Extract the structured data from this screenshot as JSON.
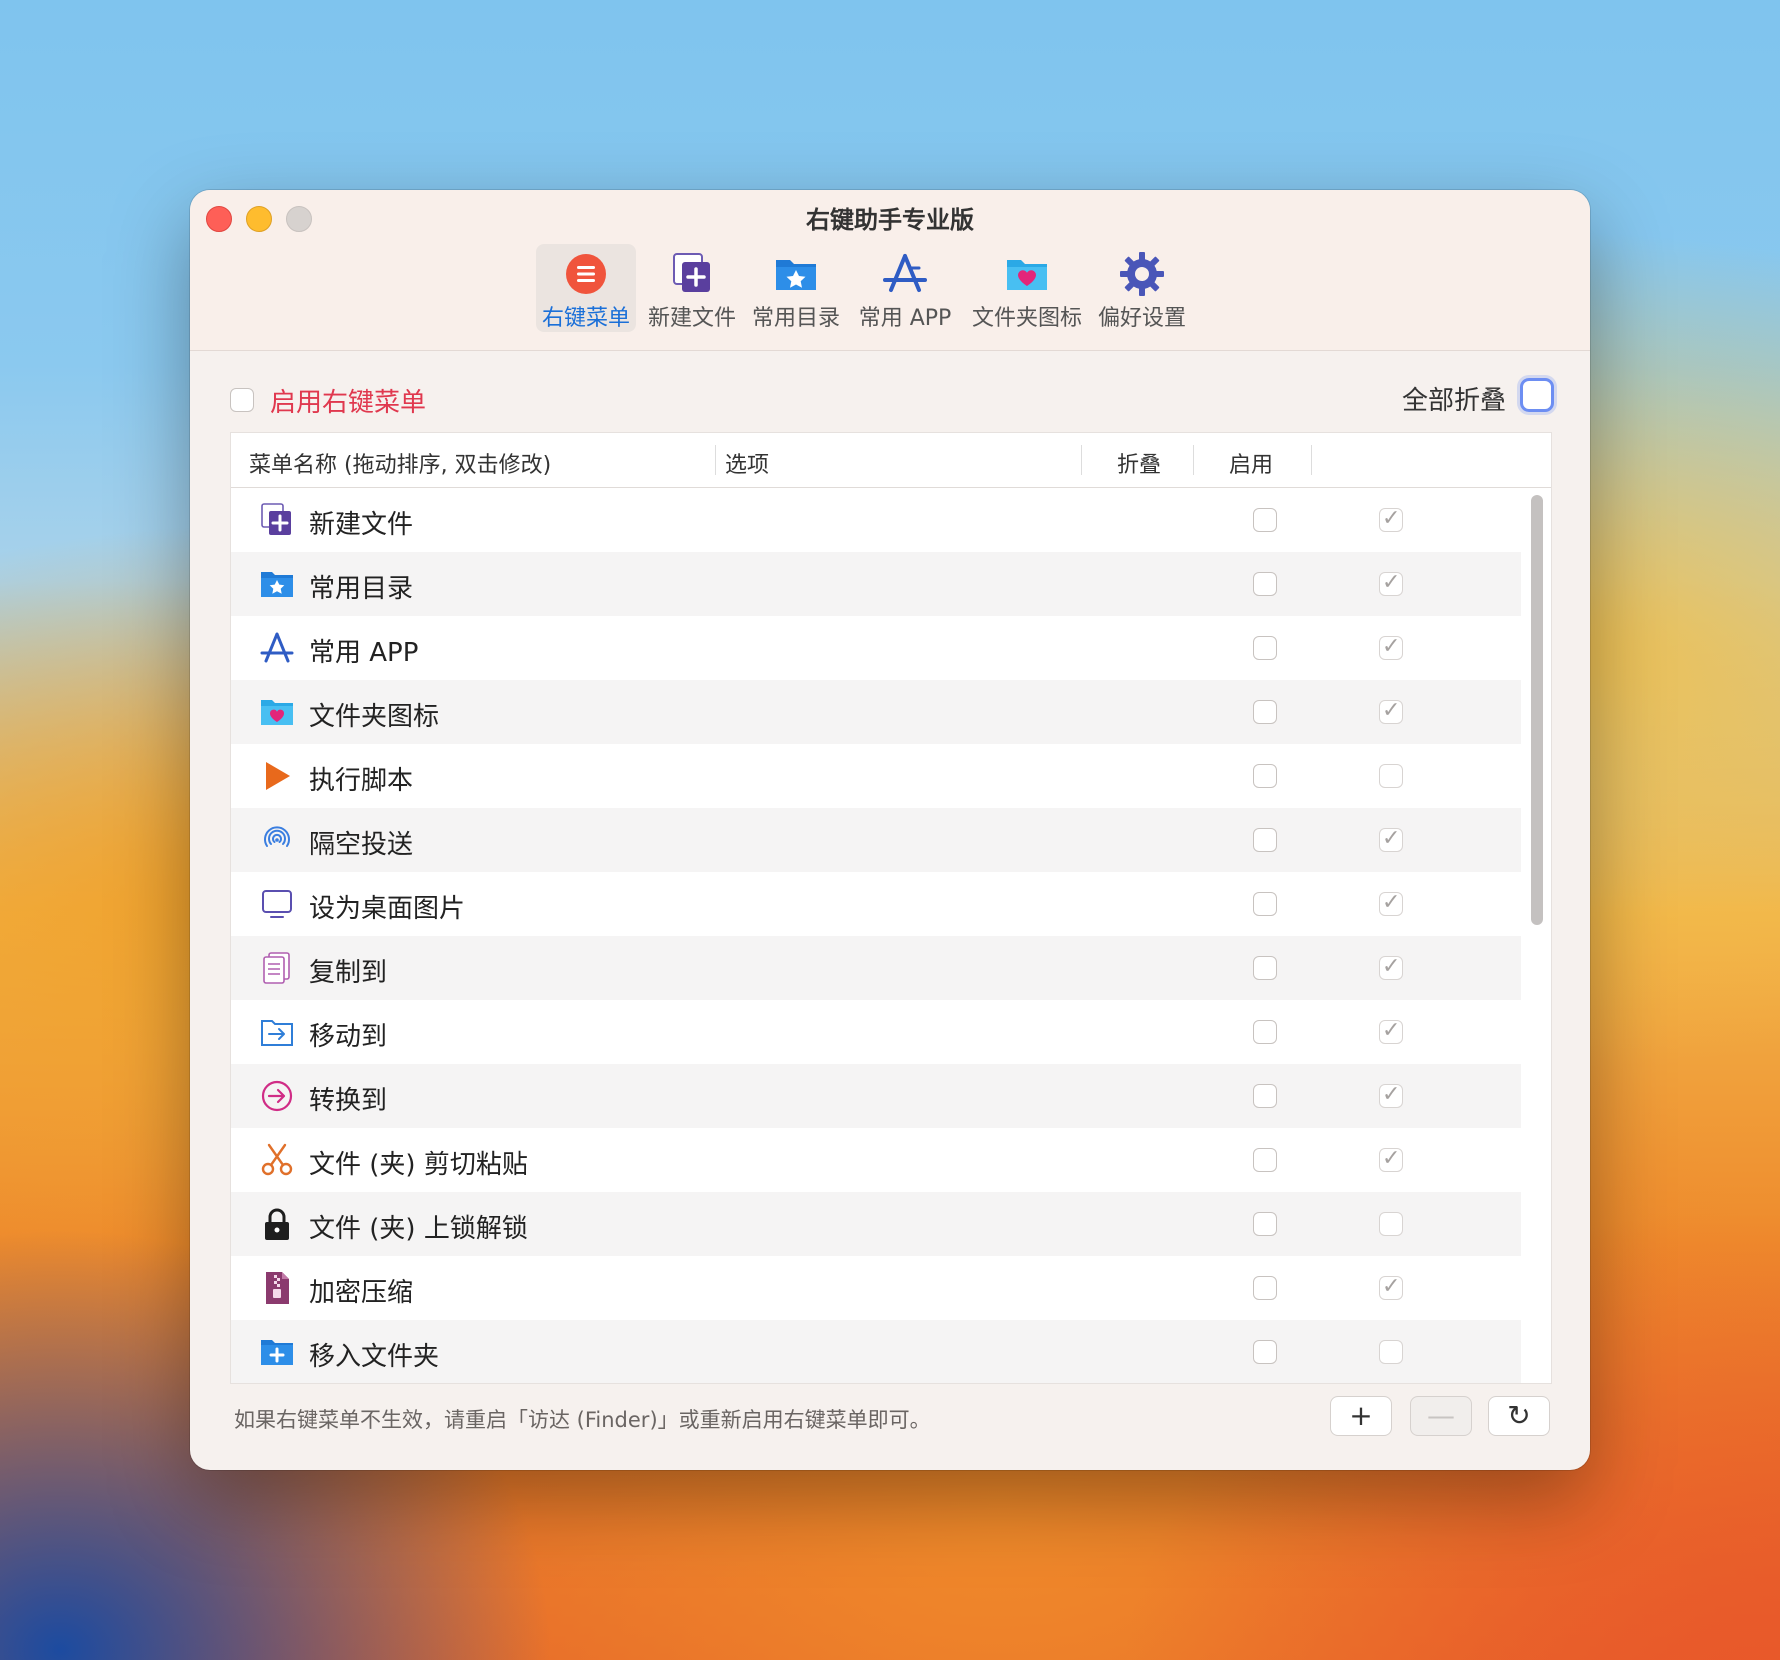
{
  "window": {
    "title": "右键助手专业版"
  },
  "toolbar": {
    "tabs": [
      {
        "label": "右键菜单",
        "icon": "context-menu-icon",
        "active": true
      },
      {
        "label": "新建文件",
        "icon": "new-file-icon",
        "active": false
      },
      {
        "label": "常用目录",
        "icon": "favorite-folder-icon",
        "active": false
      },
      {
        "label": "常用 APP",
        "icon": "app-store-icon",
        "active": false
      },
      {
        "label": "文件夹图标",
        "icon": "folder-heart-icon",
        "active": false
      },
      {
        "label": "偏好设置",
        "icon": "gear-icon",
        "active": false
      }
    ]
  },
  "settings": {
    "enable_label": "启用右键菜单",
    "enable_checked": false,
    "collapse_all_label": "全部折叠",
    "collapse_all_checked": false
  },
  "table": {
    "columns": [
      "菜单名称 (拖动排序, 双击修改)",
      "选项",
      "折叠",
      "启用"
    ],
    "rows": [
      {
        "name": "新建文件",
        "icon": "new-file-icon",
        "fold": false,
        "enabled": true
      },
      {
        "name": "常用目录",
        "icon": "favorite-folder-icon",
        "fold": false,
        "enabled": true
      },
      {
        "name": "常用 APP",
        "icon": "app-store-icon",
        "fold": false,
        "enabled": true
      },
      {
        "name": "文件夹图标",
        "icon": "folder-heart-icon",
        "fold": false,
        "enabled": true
      },
      {
        "name": "执行脚本",
        "icon": "play-icon",
        "fold": false,
        "enabled": false
      },
      {
        "name": "隔空投送",
        "icon": "airdrop-icon",
        "fold": false,
        "enabled": true
      },
      {
        "name": "设为桌面图片",
        "icon": "monitor-icon",
        "fold": false,
        "enabled": true
      },
      {
        "name": "复制到",
        "icon": "copy-document-icon",
        "fold": false,
        "enabled": true
      },
      {
        "name": "移动到",
        "icon": "move-folder-icon",
        "fold": false,
        "enabled": true
      },
      {
        "name": "转换到",
        "icon": "convert-arrow-icon",
        "fold": false,
        "enabled": true
      },
      {
        "name": "文件 (夹) 剪切粘贴",
        "icon": "scissors-icon",
        "fold": false,
        "enabled": true
      },
      {
        "name": "文件 (夹) 上锁解锁",
        "icon": "lock-icon",
        "fold": false,
        "enabled": false
      },
      {
        "name": "加密压缩",
        "icon": "zip-icon",
        "fold": false,
        "enabled": true
      },
      {
        "name": "移入文件夹",
        "icon": "add-folder-icon",
        "fold": false,
        "enabled": false
      }
    ]
  },
  "footer": {
    "note": "如果右键菜单不生效，请重启「访达 (Finder)」或重新启用右键菜单即可。",
    "add_label": "+",
    "remove_label": "—",
    "refresh_label": "↻"
  },
  "colors": {
    "accent": "#1a6fd8",
    "enable_label": "#e0384e",
    "focus_ring": "#6d8ef2"
  }
}
